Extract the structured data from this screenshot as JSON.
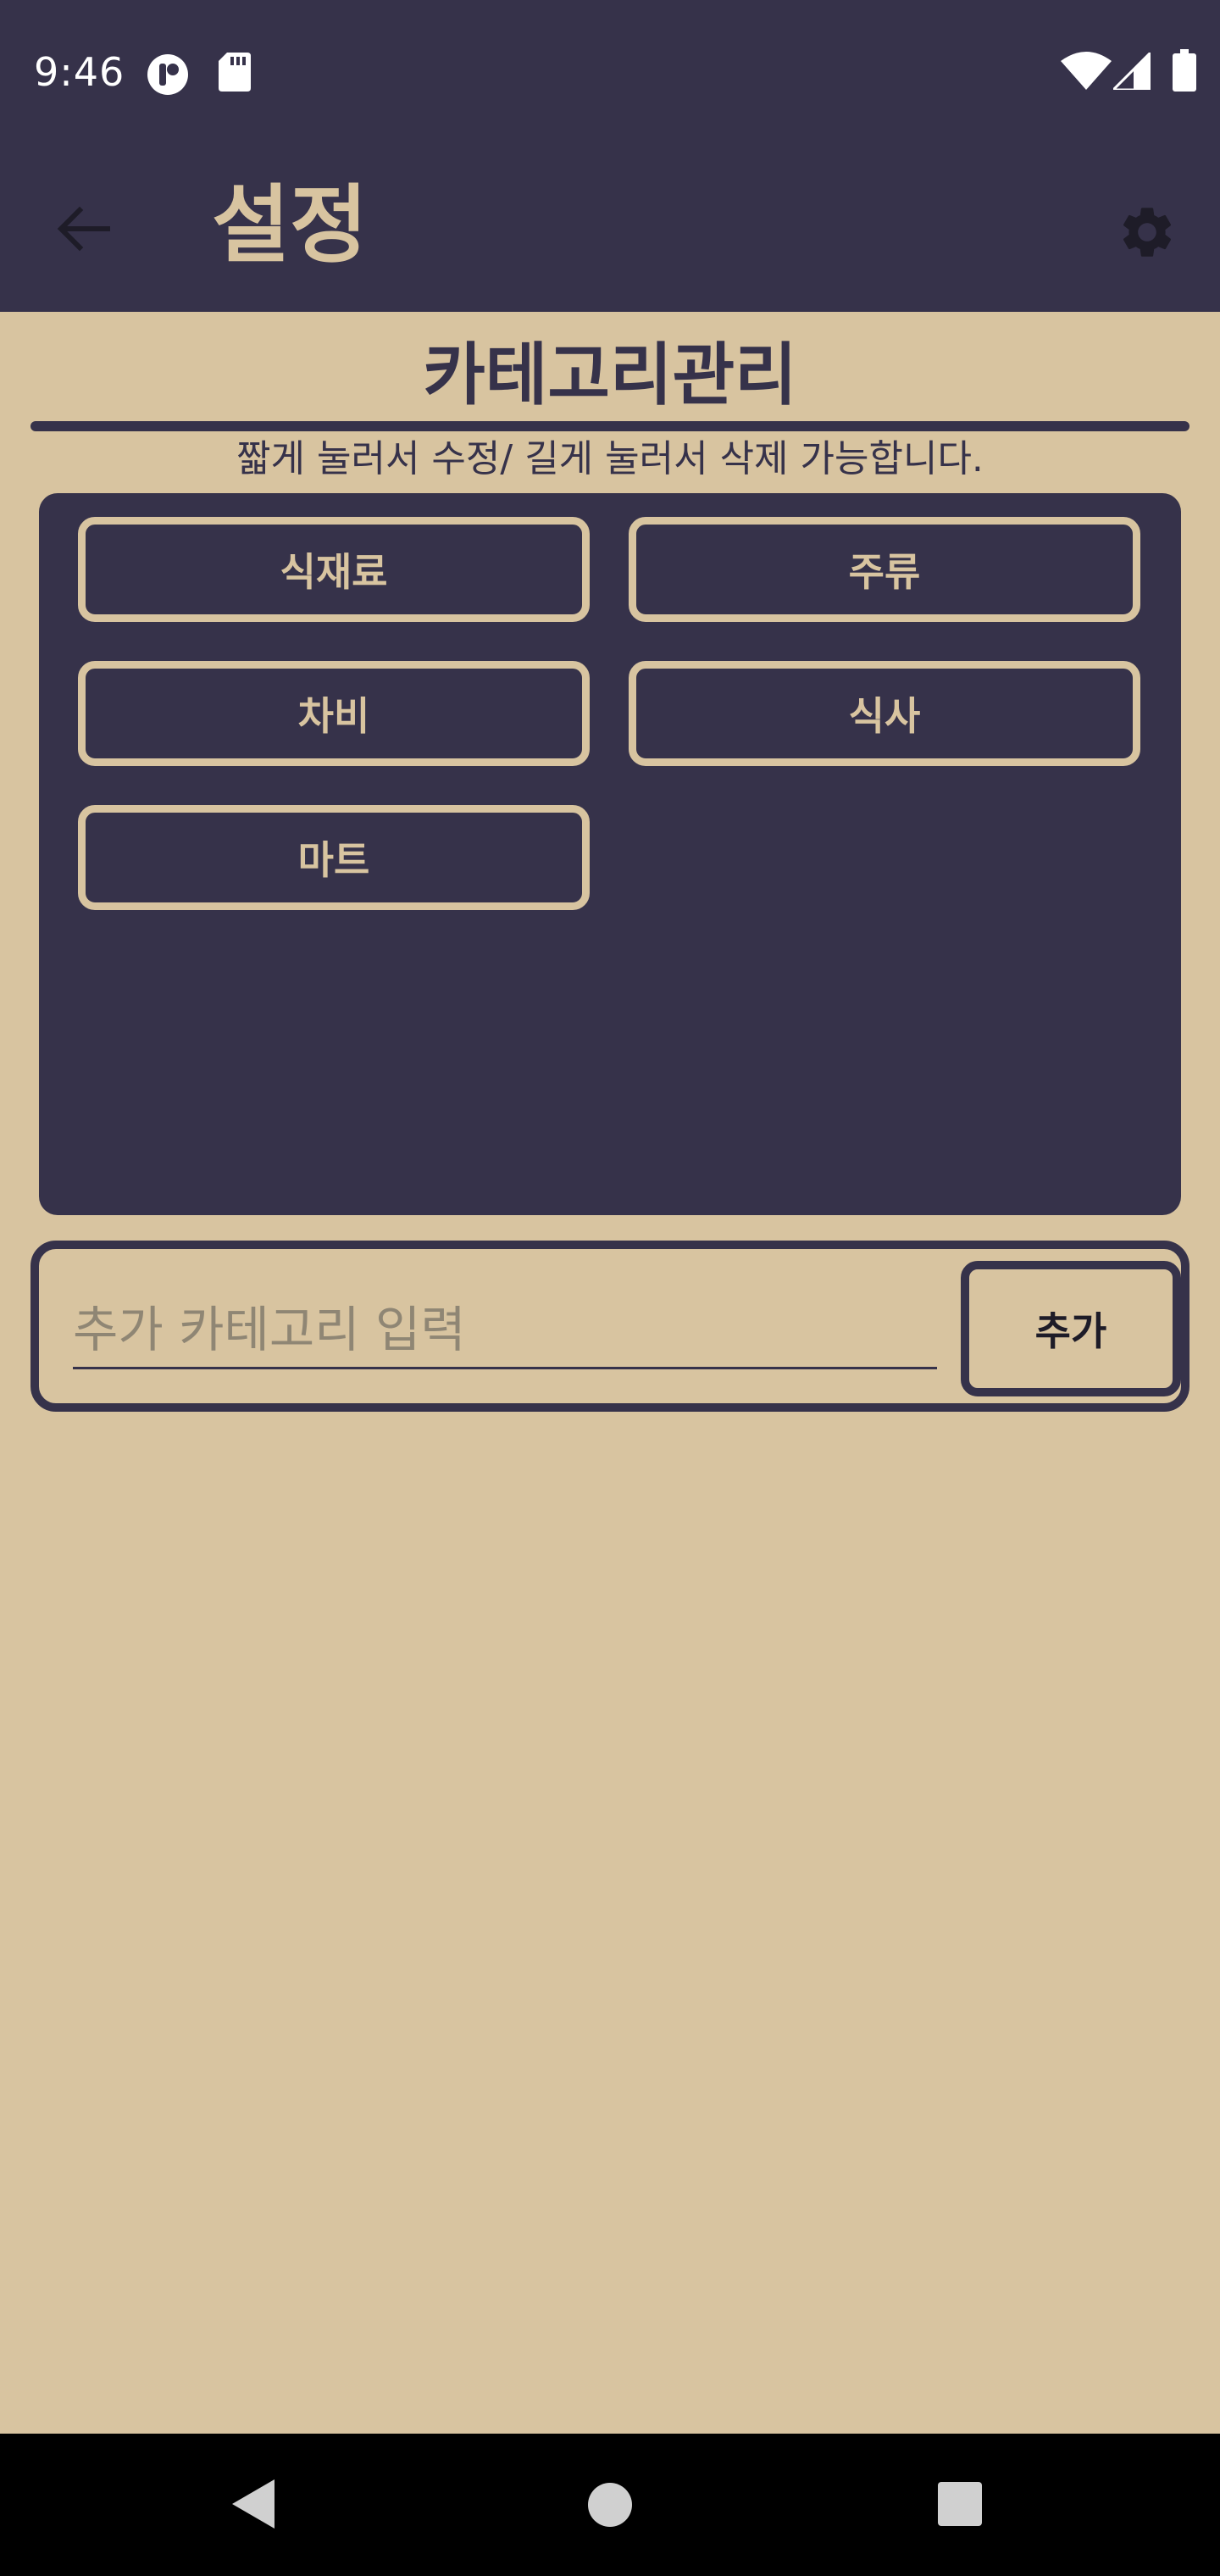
{
  "status_bar": {
    "time": "9:46",
    "left_icons": [
      "record-icon",
      "sd-card-icon"
    ],
    "right_icons": [
      "wifi-icon",
      "cell-signal-icon",
      "battery-icon"
    ]
  },
  "app_bar": {
    "title": "설정",
    "back_icon": "arrow-back-icon",
    "settings_icon": "gear-icon"
  },
  "section": {
    "title": "카테고리관리",
    "hint": "짧게 눌러서 수정/ 길게 눌러서 삭제 가능합니다."
  },
  "categories": [
    "식재료",
    "주류",
    "차비",
    "식사",
    "마트"
  ],
  "add_category": {
    "placeholder": "추가 카테고리 입력",
    "value": "",
    "button_label": "추가"
  },
  "nav_bar": {
    "icons": [
      "back-triangle-icon",
      "home-circle-icon",
      "recents-square-icon"
    ]
  },
  "colors": {
    "primary_dark": "#36324a",
    "background_beige": "#d8c4a0"
  }
}
